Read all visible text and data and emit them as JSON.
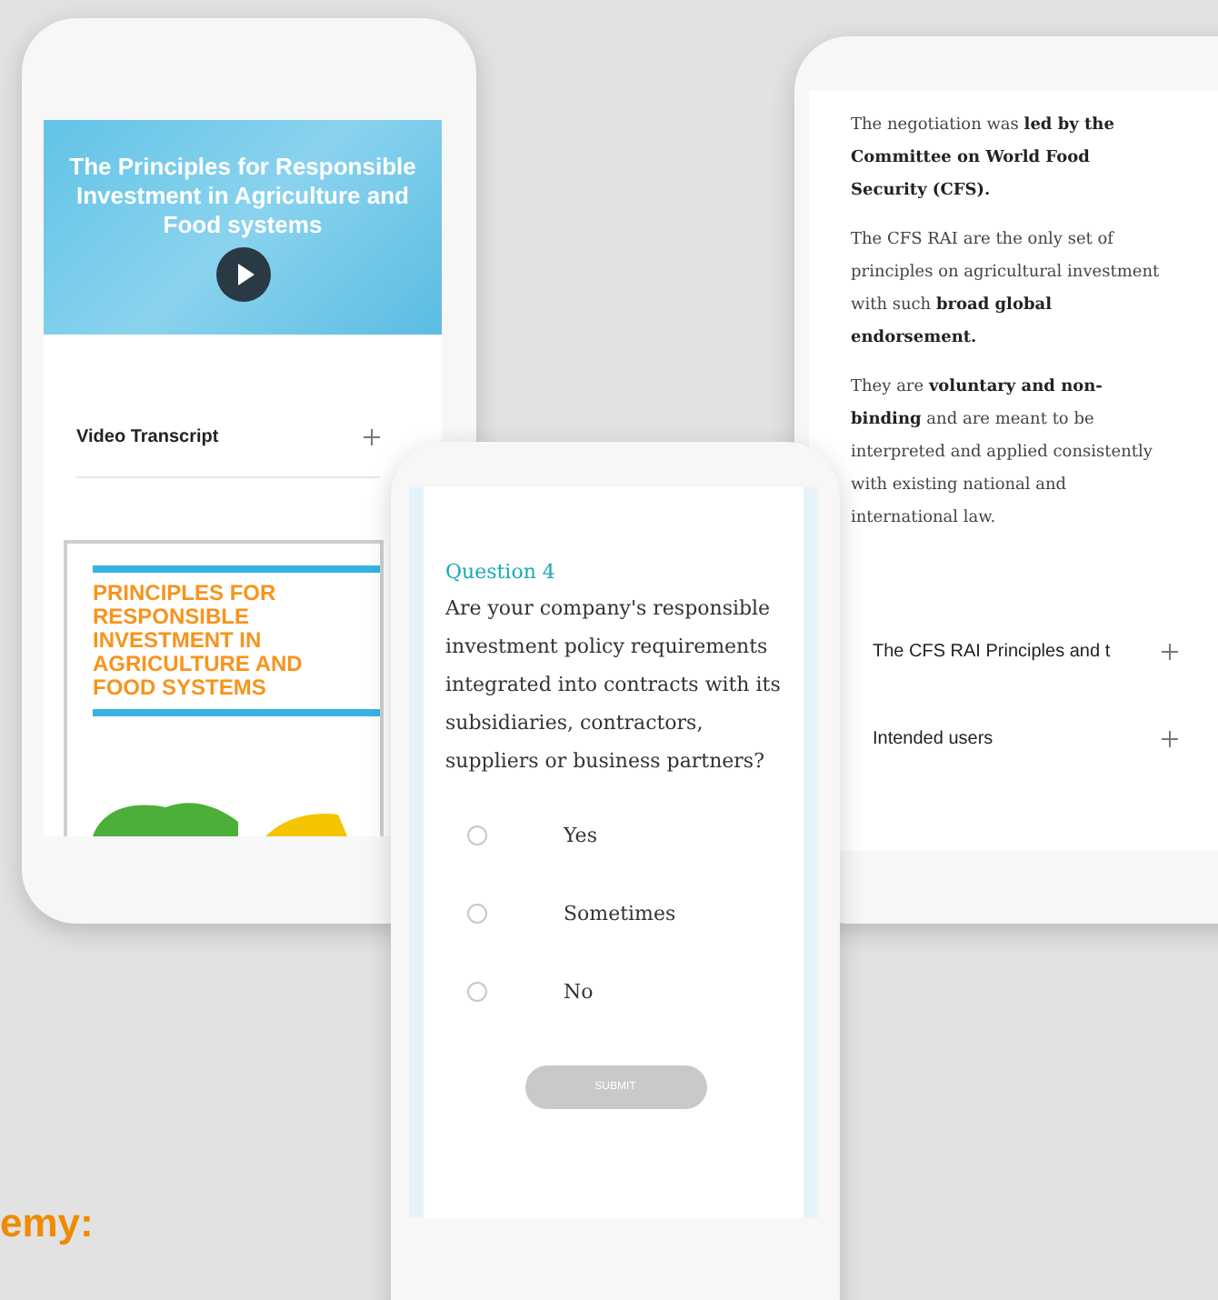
{
  "left_phone": {
    "video": {
      "title": "The Principles for Responsible Investment in Agriculture and Food systems"
    },
    "accordion": [
      {
        "label": "Video Transcript",
        "expanded": false
      }
    ],
    "document_cover": {
      "title": "PRINCIPLES FOR RESPONSIBLE INVESTMENT IN AGRICULTURE AND FOOD SYSTEMS"
    }
  },
  "right_phone": {
    "paragraphs": [
      "The negotiation was **led by the Committee on World Food Security (CFS).**",
      "The CFS RAI are the only set of principles on agricultural investment with such **broad global endorsement.**",
      "They are **voluntary and non-binding** and are meant to be interpreted and applied consistently with existing national and international law."
    ],
    "accordion": [
      {
        "label": "The CFS RAI Principles and t",
        "expanded": false
      },
      {
        "label": "Intended users",
        "expanded": false
      }
    ]
  },
  "center_phone": {
    "question_label": "Question 4",
    "question": "Are your company's responsible investment policy requirements integrated into contracts with its subsidiaries, contractors, suppliers or business partners?",
    "options": [
      {
        "label": "Yes",
        "selected": false
      },
      {
        "label": "Sometimes",
        "selected": false
      },
      {
        "label": "No",
        "selected": false
      }
    ],
    "submit": {
      "label": "SUBMIT",
      "disabled": true
    }
  },
  "caption": "emy:"
}
